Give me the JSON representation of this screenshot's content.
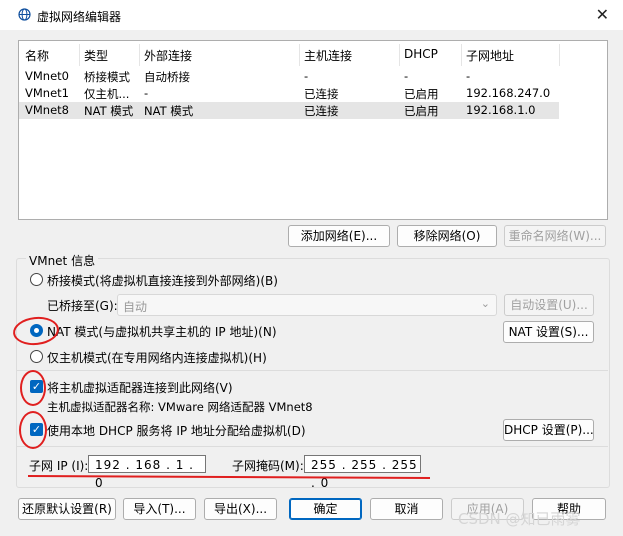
{
  "window": {
    "title": "虚拟网络编辑器",
    "close_glyph": "✕"
  },
  "table": {
    "headers": [
      "名称",
      "类型",
      "外部连接",
      "主机连接",
      "DHCP",
      "子网地址"
    ],
    "rows": [
      [
        "VMnet0",
        "桥接模式",
        "自动桥接",
        "-",
        "-",
        "-"
      ],
      [
        "VMnet1",
        "仅主机...",
        "-",
        "已连接",
        "已启用",
        "192.168.247.0"
      ],
      [
        "VMnet8",
        "NAT 模式",
        "NAT 模式",
        "已连接",
        "已启用",
        "192.168.1.0"
      ]
    ],
    "selected_row": 2
  },
  "list_buttons": {
    "add": "添加网络(E)...",
    "remove": "移除网络(O)",
    "rename": "重命名网络(W)..."
  },
  "vmnet_info": {
    "title": "VMnet 信息",
    "bridged": "桥接模式(将虚拟机直接连接到外部网络)(B)",
    "bridged_to_label": "已桥接至(G):",
    "bridged_to_value": "自动",
    "auto_settings": "自动设置(U)...",
    "nat": "NAT 模式(与虚拟机共享主机的 IP 地址)(N)",
    "nat_settings": "NAT 设置(S)...",
    "host_only": "仅主机模式(在专用网络内连接虚拟机)(H)",
    "connect_adapter": "将主机虚拟适配器连接到此网络(V)",
    "adapter_name": "主机虚拟适配器名称: VMware 网络适配器 VMnet8",
    "use_dhcp": "使用本地 DHCP 服务将 IP 地址分配给虚拟机(D)",
    "dhcp_settings": "DHCP 设置(P)...",
    "subnet_ip_label": "子网 IP (I):",
    "subnet_ip": "192 . 168 . 1 . 0",
    "subnet_mask_label": "子网掩码(M):",
    "subnet_mask": "255 . 255 . 255 . 0",
    "selected_mode": "nat",
    "connect_adapter_checked": true,
    "use_dhcp_checked": true
  },
  "footer_buttons": {
    "restore": "还原默认设置(R)",
    "import": "导入(T)...",
    "export": "导出(X)...",
    "ok": "确定",
    "cancel": "取消",
    "apply": "应用(A)",
    "help": "帮助"
  },
  "watermark": "CSDN @知已雨雾",
  "colors": {
    "accent": "#0067c0",
    "annotation": "#e01f1f"
  }
}
